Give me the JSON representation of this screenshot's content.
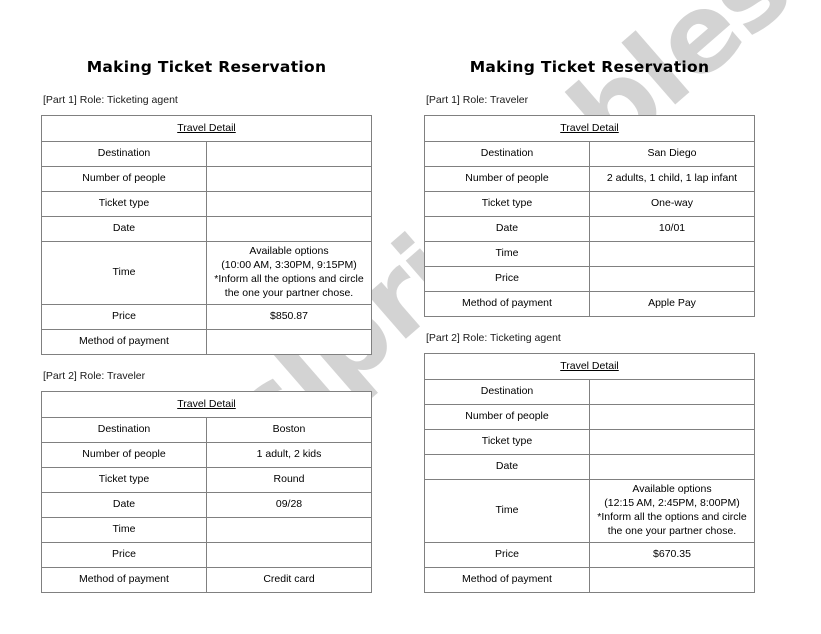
{
  "watermark": {
    "text": "eslprintables.com"
  },
  "left_column": {
    "title": "Making Ticket Reservation",
    "sections": [
      {
        "part_label": "[Part 1] Role: Ticketing agent",
        "table": {
          "header": "Travel Detail",
          "rows": [
            {
              "label": "Destination",
              "value": ""
            },
            {
              "label": "Number of people",
              "value": ""
            },
            {
              "label": "Ticket type",
              "value": ""
            },
            {
              "label": "Date",
              "value": ""
            },
            {
              "label": "Time",
              "value_lines": [
                "Available options",
                "(10:00 AM, 3:30PM, 9:15PM)",
                "*Inform all the options and circle",
                "the one your partner chose."
              ]
            },
            {
              "label": "Price",
              "value": "$850.87"
            },
            {
              "label": "Method of payment",
              "value": ""
            }
          ]
        }
      },
      {
        "part_label": "[Part 2] Role: Traveler",
        "table": {
          "header": "Travel Detail",
          "rows": [
            {
              "label": "Destination",
              "value": "Boston"
            },
            {
              "label": "Number of people",
              "value": "1 adult, 2 kids"
            },
            {
              "label": "Ticket type",
              "value": "Round"
            },
            {
              "label": "Date",
              "value": "09/28"
            },
            {
              "label": "Time",
              "value": ""
            },
            {
              "label": "Price",
              "value": ""
            },
            {
              "label": "Method of payment",
              "value": "Credit card"
            }
          ]
        }
      }
    ]
  },
  "right_column": {
    "title": "Making Ticket Reservation",
    "sections": [
      {
        "part_label": "[Part 1] Role: Traveler",
        "table": {
          "header": "Travel Detail",
          "rows": [
            {
              "label": "Destination",
              "value": "San Diego"
            },
            {
              "label": "Number of people",
              "value": "2 adults, 1 child, 1 lap infant"
            },
            {
              "label": "Ticket type",
              "value": "One-way"
            },
            {
              "label": "Date",
              "value": "10/01"
            },
            {
              "label": "Time",
              "value": ""
            },
            {
              "label": "Price",
              "value": ""
            },
            {
              "label": "Method of payment",
              "value": "Apple Pay"
            }
          ]
        }
      },
      {
        "part_label": "[Part 2] Role: Ticketing agent",
        "table": {
          "header": "Travel Detail",
          "rows": [
            {
              "label": "Destination",
              "value": ""
            },
            {
              "label": "Number of people",
              "value": ""
            },
            {
              "label": "Ticket type",
              "value": ""
            },
            {
              "label": "Date",
              "value": ""
            },
            {
              "label": "Time",
              "value_lines": [
                "Available options",
                "(12:15 AM, 2:45PM, 8:00PM)",
                "*Inform all the options and circle",
                "the one your partner chose."
              ]
            },
            {
              "label": "Price",
              "value": "$670.35"
            },
            {
              "label": "Method of payment",
              "value": ""
            }
          ]
        }
      }
    ]
  }
}
